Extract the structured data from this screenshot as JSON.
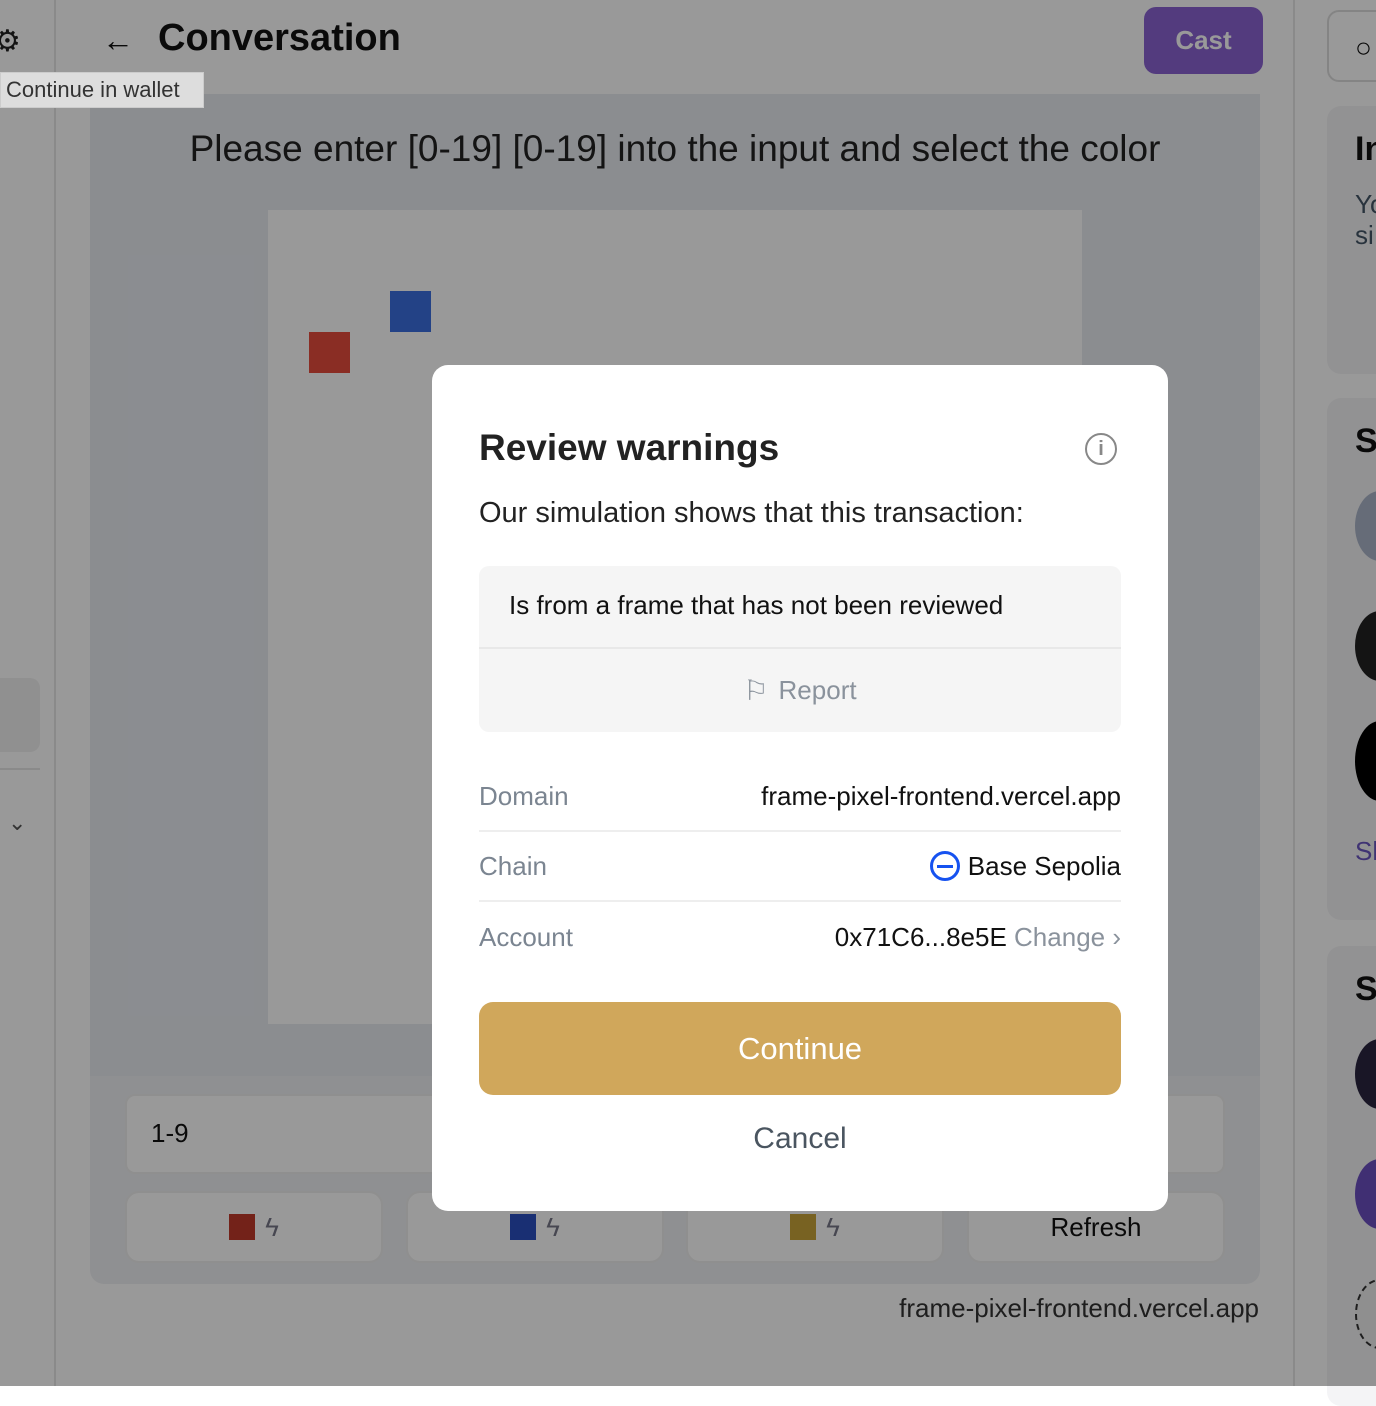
{
  "header": {
    "title": "Conversation",
    "cast_label": "Cast"
  },
  "tooltip": "Continue in wallet",
  "frame": {
    "prompt": "Please enter [0-19] [0-19] into the input and select the color",
    "input_value": "1-9",
    "buttons": [
      {
        "color": "#c0392b"
      },
      {
        "color": "#2b4fc0"
      },
      {
        "color": "#c9a33a"
      },
      {
        "label": "Refresh"
      }
    ],
    "domain": "frame-pixel-frontend.vercel.app",
    "pixels": [
      {
        "x": 1,
        "y": 3,
        "color": "#e74c3c"
      },
      {
        "x": 3,
        "y": 2,
        "color": "#3b6fe0"
      }
    ]
  },
  "right": {
    "h1": "In",
    "t1": "Yo",
    "t2": "si",
    "h2": "S",
    "link": "Sh",
    "h3": "S"
  },
  "modal": {
    "title": "Review warnings",
    "subtitle": "Our simulation shows that this transaction:",
    "warning": "Is from a frame that has not been reviewed",
    "report_label": "Report",
    "details": [
      {
        "label": "Domain",
        "value": "frame-pixel-frontend.vercel.app"
      },
      {
        "label": "Chain",
        "value": "Base Sepolia"
      },
      {
        "label": "Account",
        "value": "0x71C6...8e5E",
        "action": "Change"
      }
    ],
    "continue_label": "Continue",
    "cancel_label": "Cancel",
    "accent": "#d0a75b"
  }
}
